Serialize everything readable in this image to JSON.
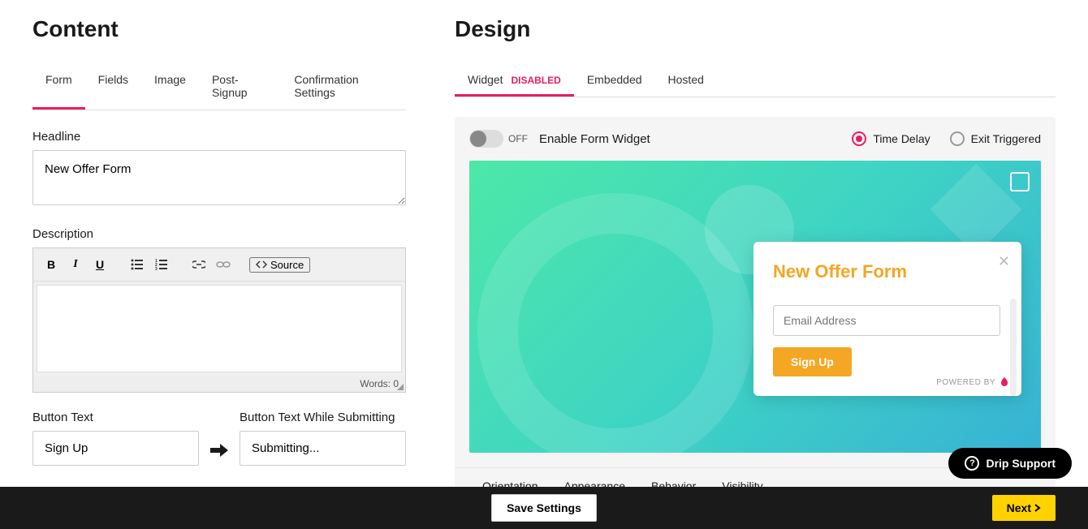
{
  "content": {
    "heading": "Content",
    "tabs": [
      "Form",
      "Fields",
      "Image",
      "Post-Signup",
      "Confirmation Settings"
    ],
    "headline": {
      "label": "Headline",
      "value": "New Offer Form"
    },
    "description": {
      "label": "Description",
      "toolbar": {
        "source_label": "Source"
      },
      "words_label": "Words: 0"
    },
    "button_text": {
      "label": "Button Text",
      "value": "Sign Up"
    },
    "button_text_submitting": {
      "label": "Button Text While Submitting",
      "value": "Submitting..."
    }
  },
  "design": {
    "heading": "Design",
    "tabs": [
      {
        "label": "Widget",
        "badge": "DISABLED"
      },
      {
        "label": "Embedded",
        "badge": null
      },
      {
        "label": "Hosted",
        "badge": null
      }
    ],
    "widget": {
      "toggle_state": "OFF",
      "enable_label": "Enable Form Widget",
      "radios": {
        "time_delay": "Time Delay",
        "exit_triggered": "Exit Triggered"
      }
    },
    "preview": {
      "form_title": "New Offer Form",
      "email_placeholder": "Email Address",
      "button_label": "Sign Up",
      "powered_by": "POWERED BY"
    },
    "subtabs": [
      "Orientation",
      "Appearance",
      "Behavior",
      "Visibility"
    ]
  },
  "footer": {
    "save": "Save Settings",
    "next": "Next"
  },
  "support": "Drip Support"
}
